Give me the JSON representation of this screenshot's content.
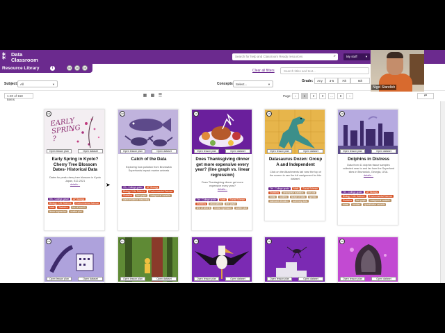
{
  "header": {
    "logo_line1": "Data",
    "logo_line2": "Classroom",
    "search_placeholder": "Search for help and Classroom Ready resources",
    "my_stuff": "My stuff"
  },
  "resource_bar": {
    "title": "Resource Library",
    "badges": [
      "CR",
      "CR",
      "CR"
    ]
  },
  "filters": {
    "clear_filters": "Clear all filters",
    "search_placeholder": "Search titles and text...",
    "grade_label": "Grade:",
    "grades": [
      "Any",
      "3-5",
      "7th",
      "6th"
    ],
    "subject_label": "Subject:",
    "subject_value": "All",
    "concepts_label": "Concepts:",
    "concepts_value": "Select..."
  },
  "listing": {
    "count": "1-20 of 168 Items",
    "page_label": "Page:",
    "pages": [
      "‹",
      "1",
      "2",
      "3",
      "…",
      "8",
      "›"
    ],
    "refresh": "⇄"
  },
  "cards": [
    {
      "badge": "CR",
      "image_text": "EARLY SPRING ?",
      "btn_plan": "Open lesson plan",
      "btn_data": "Open dataset",
      "title": "Early Spring in Kyoto? Cherry Tree Blossom Dates- Historical Data",
      "desc": "Dates for peak cherry tree blossom in Kyoto Japan, 812-2021",
      "details": "details...",
      "tags": [
        {
          "text": "9th - College grade",
          "color": "#6b2a8e"
        },
        {
          "text": "AP Biology",
          "color": "#d6562a"
        },
        {
          "text": "Biology / Life Science",
          "color": "#d6562a"
        },
        {
          "text": "Environmental Science",
          "color": "#d6562a"
        },
        {
          "text": "Math",
          "color": "#d6562a"
        },
        {
          "text": "Statistics",
          "color": "#d6562a"
        },
        {
          "text": "line of best fit",
          "color": "#b9956a"
        },
        {
          "text": "linear regression",
          "color": "#b9956a"
        },
        {
          "text": "scatter plot",
          "color": "#b9956a"
        }
      ]
    },
    {
      "badge": "CR",
      "btn_plan": "Open lesson plan",
      "btn_data": "Open dataset",
      "title": "Catch of the Data",
      "desc": "Exploring how pollution from Brunswick Superfunds impact marine animals",
      "details": "",
      "tags": [
        {
          "text": "7th - College grade",
          "color": "#6b2a8e"
        },
        {
          "text": "AP Biology",
          "color": "#d6562a"
        },
        {
          "text": "Biology / Life Science",
          "color": "#d6562a"
        },
        {
          "text": "Environmental Science",
          "color": "#d6562a"
        },
        {
          "text": "Statistics",
          "color": "#d6562a"
        },
        {
          "text": "bar graph",
          "color": "#b9956a"
        },
        {
          "text": "categorical variable",
          "color": "#b9956a"
        },
        {
          "text": "claim evidence reasoning",
          "color": "#b9956a"
        }
      ]
    },
    {
      "badge": "CR",
      "btn_plan": "Open lesson plan",
      "btn_data": "Open dataset",
      "title": "Does Thanksgiving dinner get more expensive every year? (line graph vs. linear regression)",
      "desc": "Does Thanksgiving dinner get more expensive every year?",
      "details": "details...",
      "tags": [
        {
          "text": "7th - College grade",
          "color": "#6b2a8e"
        },
        {
          "text": "Math",
          "color": "#d6562a"
        },
        {
          "text": "Social Science",
          "color": "#d6562a"
        },
        {
          "text": "Statistics",
          "color": "#d6562a"
        },
        {
          "text": "association",
          "color": "#b9956a"
        },
        {
          "text": "line graph",
          "color": "#b9956a"
        },
        {
          "text": "line of best fit",
          "color": "#b9956a"
        },
        {
          "text": "linear regression",
          "color": "#b9956a"
        },
        {
          "text": "scatter plot",
          "color": "#b9956a"
        }
      ]
    },
    {
      "badge": "CR",
      "btn_plan": "Open lesson plan",
      "btn_data": "Open dataset",
      "title": "Datasaurus Dozen: Group A and Independent",
      "desc": "Click on the Attachments tab near the top of the screen to see the full assignment for this dataset.",
      "details": "",
      "tags": [
        {
          "text": "7th - College grade",
          "color": "#6b2a8e"
        },
        {
          "text": "Math",
          "color": "#d6562a"
        },
        {
          "text": "Social Science",
          "color": "#d6562a"
        },
        {
          "text": "Statistics",
          "color": "#d6562a"
        },
        {
          "text": "descriptive statistics",
          "color": "#b9956a"
        },
        {
          "text": "dot plot",
          "color": "#b9956a"
        },
        {
          "text": "mean",
          "color": "#b9956a"
        },
        {
          "text": "outliers",
          "color": "#b9956a"
        },
        {
          "text": "shape of data",
          "color": "#b9956a"
        },
        {
          "text": "spread",
          "color": "#b9956a"
        },
        {
          "text": "standard deviation",
          "color": "#b9956a"
        },
        {
          "text": "summary data",
          "color": "#b9956a"
        }
      ]
    },
    {
      "badge": "CR",
      "btn_plan": "Open lesson plan",
      "btn_data": "Open dataset",
      "title": "Dolphins in Distress",
      "desc": "Data from 41 dolphin tissue samples collected near to and far from the Superfund sites in Brunswick, Georgia, USA.",
      "details": "details...",
      "tags": [
        {
          "text": "7th - College grade",
          "color": "#6b2a8e"
        },
        {
          "text": "AP Biology",
          "color": "#d6562a"
        },
        {
          "text": "Biology / Life Science",
          "color": "#d6562a"
        },
        {
          "text": "Environmental Science",
          "color": "#d6562a"
        },
        {
          "text": "Statistics",
          "color": "#d6562a"
        },
        {
          "text": "bar graph",
          "color": "#b9956a"
        },
        {
          "text": "categorical variable",
          "color": "#b9956a"
        },
        {
          "text": "mean",
          "color": "#b9956a"
        },
        {
          "text": "median",
          "color": "#b9956a"
        },
        {
          "text": "quantitative variable",
          "color": "#b9956a"
        }
      ]
    }
  ],
  "cards_row2": [
    {
      "badge": "CR",
      "btn_plan": "Open lesson plan",
      "btn_data": "Open dataset"
    },
    {
      "badge": "Bx",
      "btn_plan": "Open lesson plan",
      "btn_data": "Open dataset"
    },
    {
      "badge": "CR",
      "btn_plan": "Open lesson plan",
      "btn_data": "Open dataset"
    },
    {
      "badge": "CR",
      "btn_plan": "Open lesson plan",
      "btn_data": "Open dataset"
    },
    {
      "badge": "CR",
      "btn_plan": "Open lesson plan",
      "btn_data": "Open dataset"
    }
  ],
  "webcam": {
    "name": "Nigel Standish"
  },
  "colors": {
    "brand": "#6b2a8e",
    "subject_tag": "#d6562a",
    "concept_tag": "#b9956a"
  }
}
